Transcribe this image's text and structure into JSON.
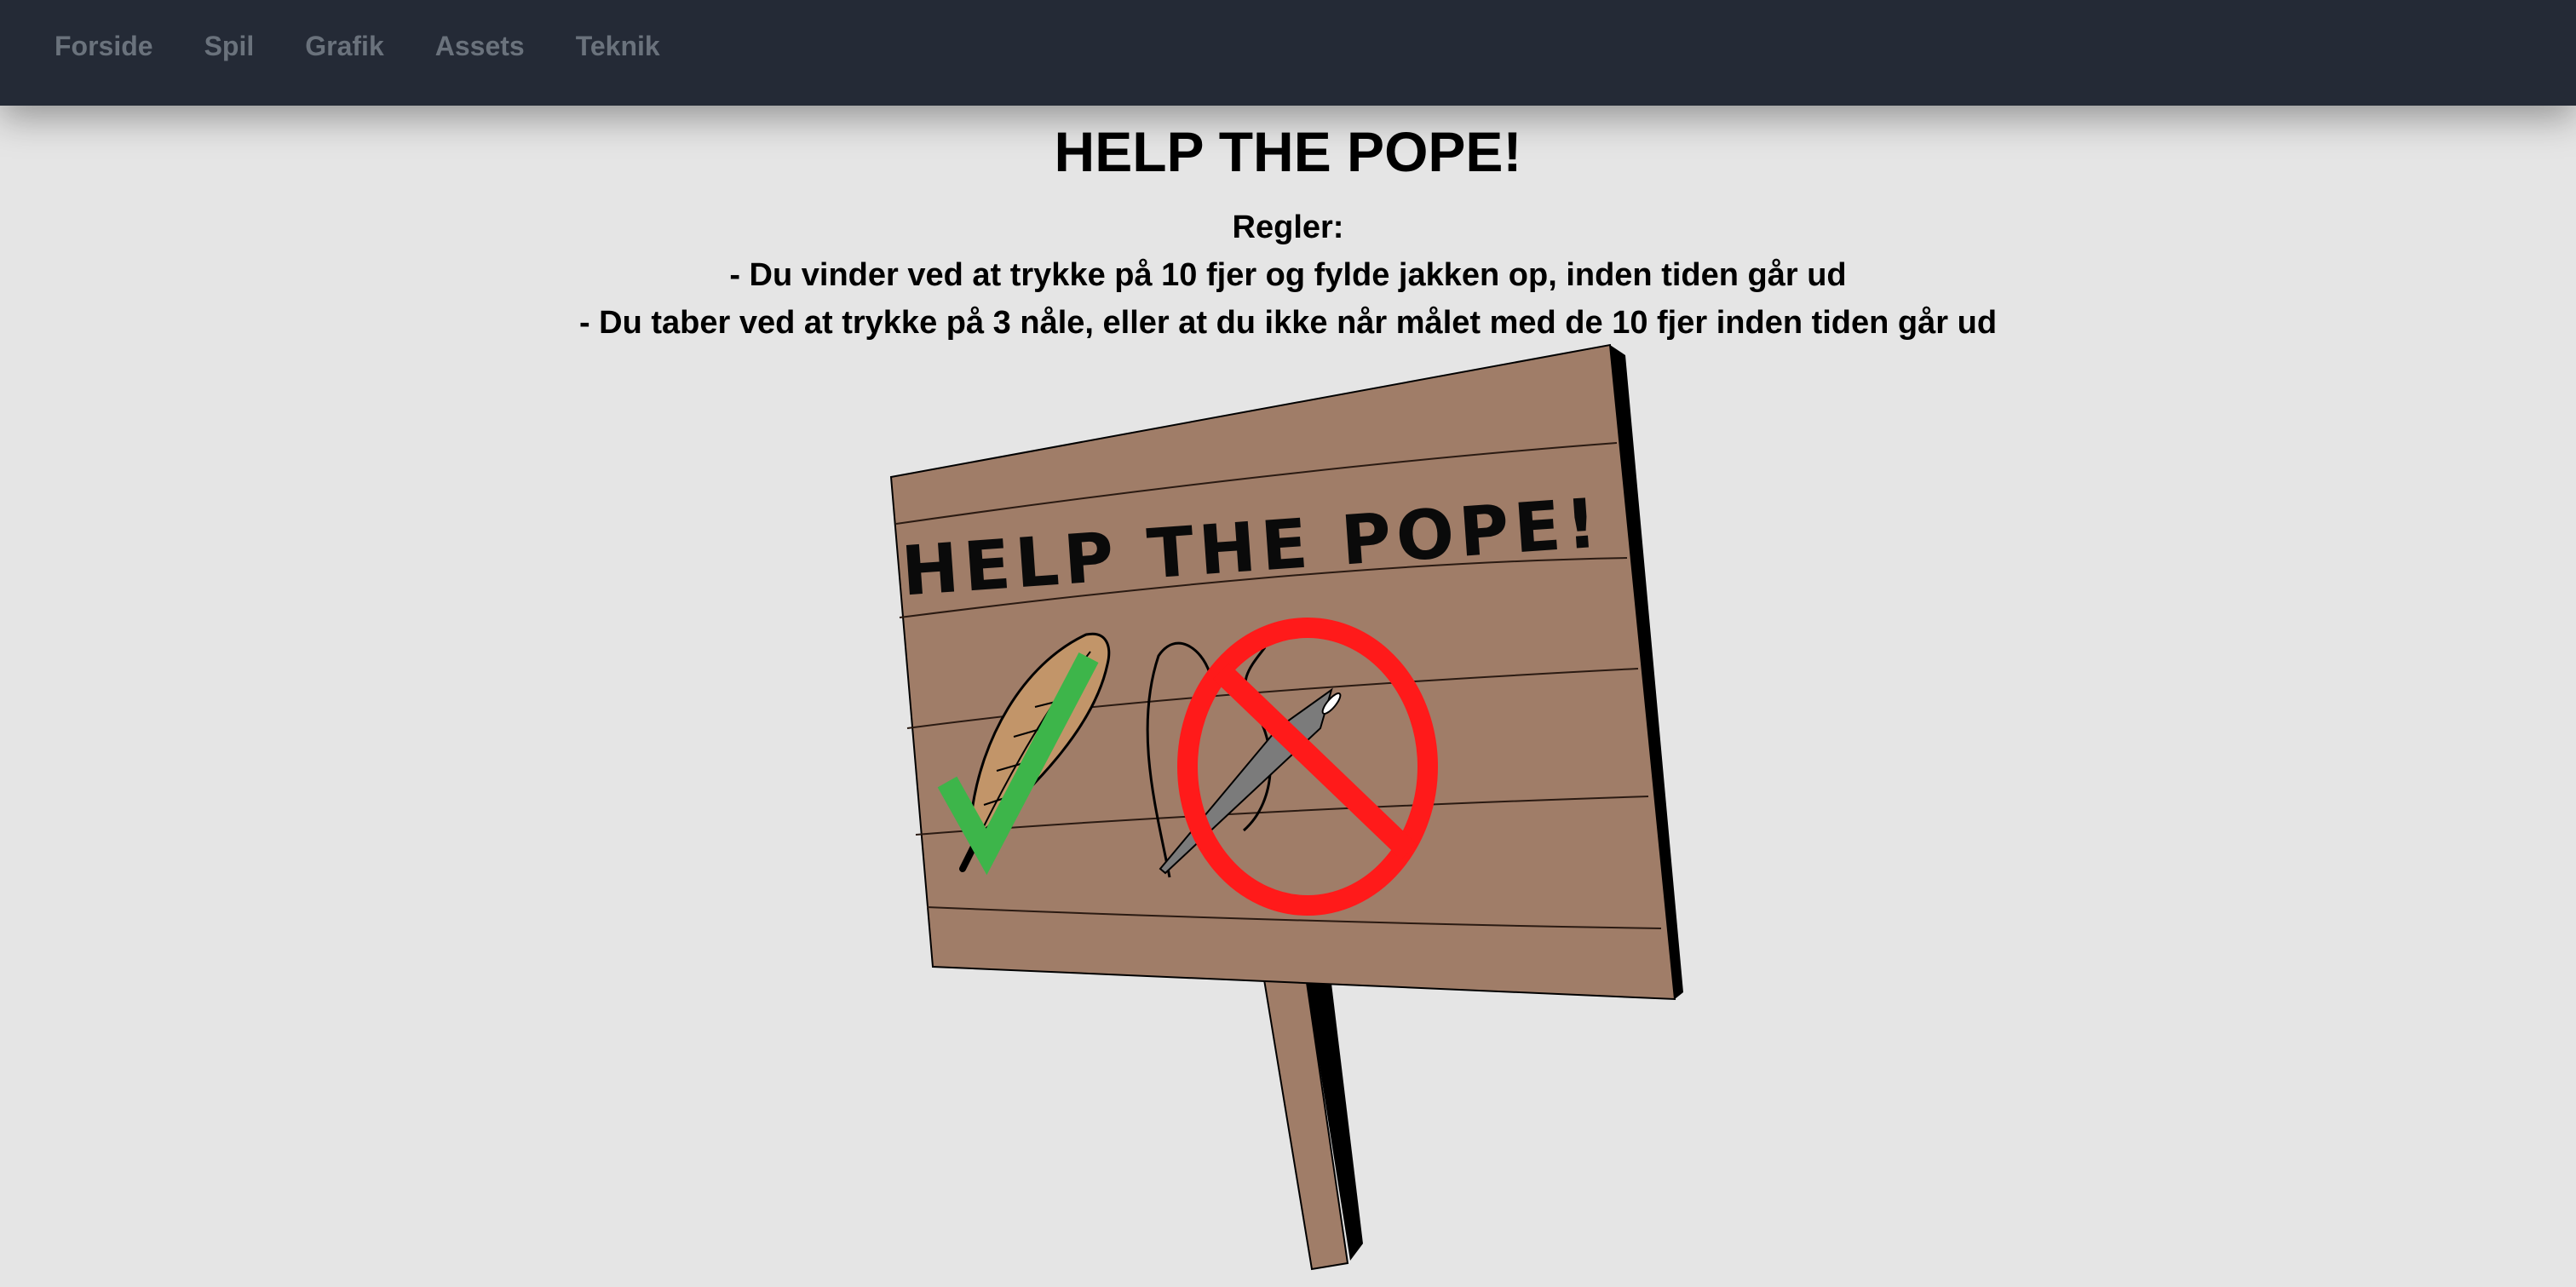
{
  "nav": {
    "items": [
      "Forside",
      "Spil",
      "Grafik",
      "Assets",
      "Teknik"
    ]
  },
  "page": {
    "title": "HELP THE POPE!",
    "rules_heading": "Regler:",
    "rules": [
      "- Du vinder ved at trykke på 10 fjer og fylde jakken op, inden tiden går ud",
      "- Du taber ved at trykke på 3 nåle, eller at du ikke når målet med de 10 fjer inden tiden går ud"
    ]
  },
  "sign": {
    "text": "HELP THE POPE!",
    "icons": [
      "feather-check-icon",
      "needle-forbidden-icon"
    ]
  },
  "colors": {
    "navbar_bg": "#242a36",
    "nav_text": "#6a727c",
    "page_bg": "#e5e5e5",
    "wood": "#a07d68",
    "check_green": "#3db54a",
    "forbidden_red": "#ff1a1a"
  }
}
